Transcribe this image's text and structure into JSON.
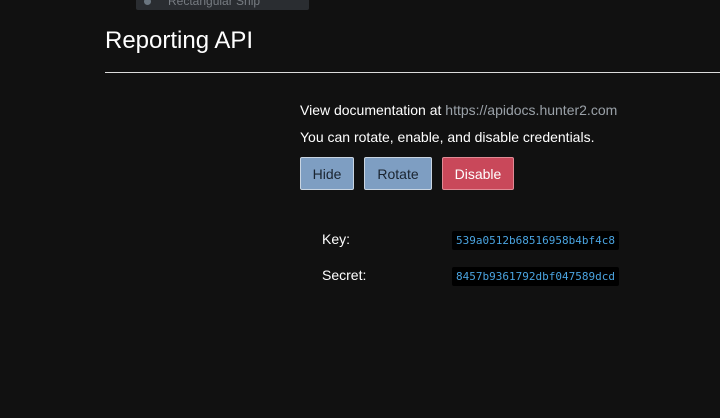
{
  "top_dropdown": {
    "item_label": "Rectangular Snip"
  },
  "header": {
    "title": "Reporting API"
  },
  "docs": {
    "prefix": "View documentation at ",
    "link_text": "https://apidocs.hunter2.com"
  },
  "info": {
    "rotate_note": "You can rotate, enable, and disable credentials."
  },
  "actions": {
    "hide_label": "Hide",
    "rotate_label": "Rotate",
    "disable_label": "Disable"
  },
  "credentials": {
    "key_label": "Key:",
    "key_value": "539a0512b68516958b4bf4c8",
    "secret_label": "Secret:",
    "secret_value": "8457b9361792dbf047589dcd"
  },
  "colors": {
    "background": "#111111",
    "primary_button": "#7e9ec2",
    "danger_button": "#c9485a",
    "code_text": "#4aa3df"
  }
}
